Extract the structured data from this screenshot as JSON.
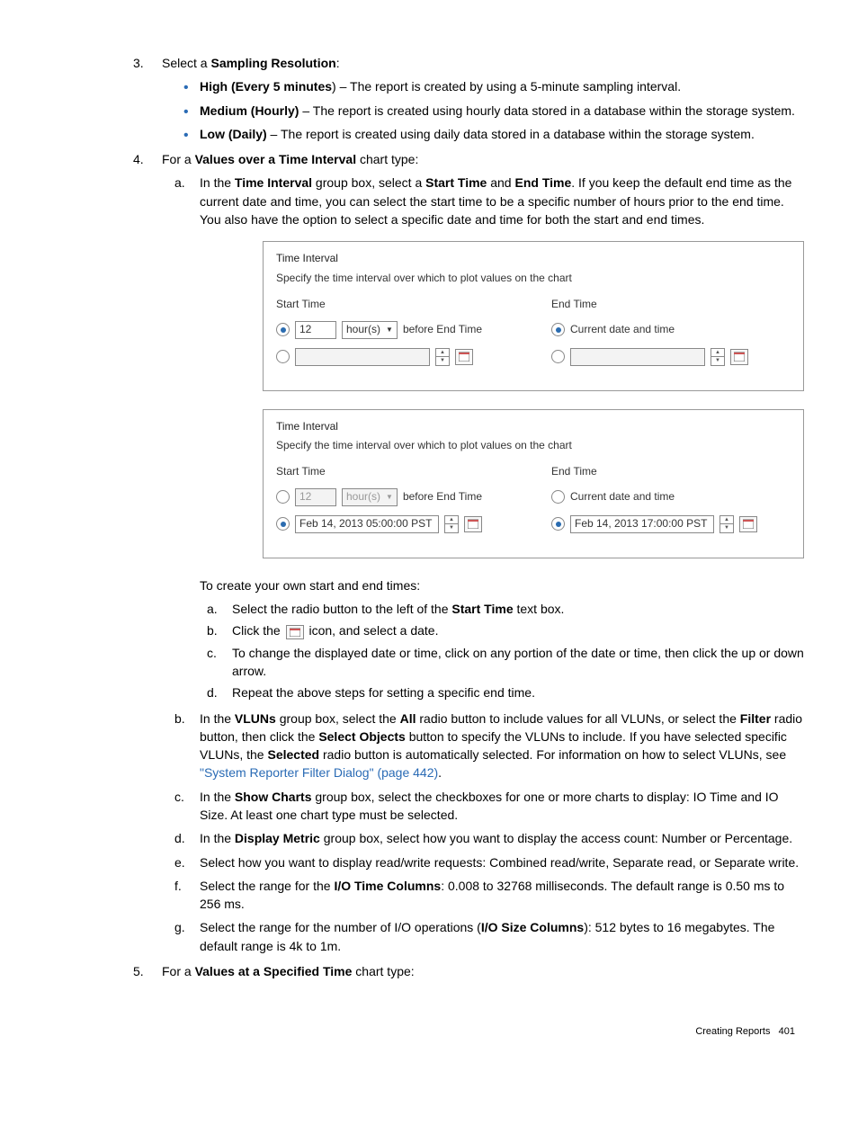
{
  "steps": {
    "s3": {
      "num": "3.",
      "text_pre": "Select a ",
      "bold": "Sampling Resolution",
      "text_post": ":",
      "bullets": [
        {
          "b": "High (Every 5 minutes",
          "after": ") – The report is created by using a 5-minute sampling interval."
        },
        {
          "b": "Medium (Hourly)",
          "after": " – The report is created using hourly data stored in a database within the storage system."
        },
        {
          "b": "Low (Daily)",
          "after": " – The report is created using daily data stored in a database within the storage system."
        }
      ]
    },
    "s4": {
      "num": "4.",
      "text_pre": "For a ",
      "bold": "Values over a Time Interval",
      "text_post": " chart type:",
      "a": {
        "num": "a.",
        "parts": [
          "In the ",
          "Time Interval",
          " group box, select a ",
          "Start Time",
          " and ",
          "End Time",
          ". If you keep the default end time as the current date and time, you can select the start time to be a specific number of hours prior to the end time. You also have the option to select a specific date and time for both the start and end times."
        ]
      },
      "own_intro": "To create your own start and end times:",
      "own_a": {
        "num": "a.",
        "parts": [
          "Select the radio button to the left of the ",
          "Start Time",
          " text box."
        ]
      },
      "own_b": {
        "num": "b.",
        "parts": [
          "Click the ",
          " icon, and select a date."
        ]
      },
      "own_c": {
        "num": "c.",
        "text": "To change the displayed date or time, click on any portion of the date or time, then click the up or down arrow."
      },
      "own_d": {
        "num": "d.",
        "text": "Repeat the above steps for setting a specific end time."
      },
      "b": {
        "num": "b.",
        "parts": [
          "In the ",
          "VLUNs",
          " group box, select the ",
          "All",
          " radio button to include values for all VLUNs, or select the ",
          "Filter",
          " radio button, then click the ",
          "Select Objects",
          "  button to specify the VLUNs to include. If you have selected specific VLUNs, the ",
          "Selected",
          " radio button is automatically selected. For information on how to select VLUNs, see "
        ],
        "link": "\"System Reporter Filter Dialog\" (page 442)",
        "tail": "."
      },
      "c": {
        "num": "c.",
        "parts": [
          "In the ",
          "Show Charts",
          " group box, select the checkboxes for one or more charts to display: IO Time and IO Size. At least one chart type must be selected."
        ]
      },
      "d": {
        "num": "d.",
        "parts": [
          "In the ",
          "Display Metric",
          " group box, select how you want to display the access count: Number or Percentage."
        ]
      },
      "e": {
        "num": "e.",
        "text": "Select how you want to display read/write requests: Combined read/write, Separate read, or Separate write."
      },
      "f": {
        "num": "f.",
        "parts": [
          "Select the range for the ",
          "I/O Time Columns",
          ": 0.008 to 32768 milliseconds. The default range is 0.50 ms to 256 ms."
        ]
      },
      "g": {
        "num": "g.",
        "parts": [
          "Select the range for the number of I/O operations (",
          "I/O Size Columns",
          "): 512 bytes to 16 megabytes. The default range is 4k to 1m."
        ]
      }
    },
    "s5": {
      "num": "5.",
      "text_pre": "For a ",
      "bold": "Values at a Specified Time",
      "text_post": " chart type:"
    }
  },
  "fig": {
    "title": "Time Interval",
    "desc": "Specify the time interval over which to plot values on the chart",
    "start_label": "Start Time",
    "end_label": "End Time",
    "before": "before End Time",
    "hours": "hour(s)",
    "twelve": "12",
    "current": "Current date and time",
    "date_start": "Feb 14, 2013 05:00:00 PST",
    "date_end": "Feb 14, 2013 17:00:00 PST"
  },
  "footer": {
    "label": "Creating Reports",
    "page": "401"
  }
}
